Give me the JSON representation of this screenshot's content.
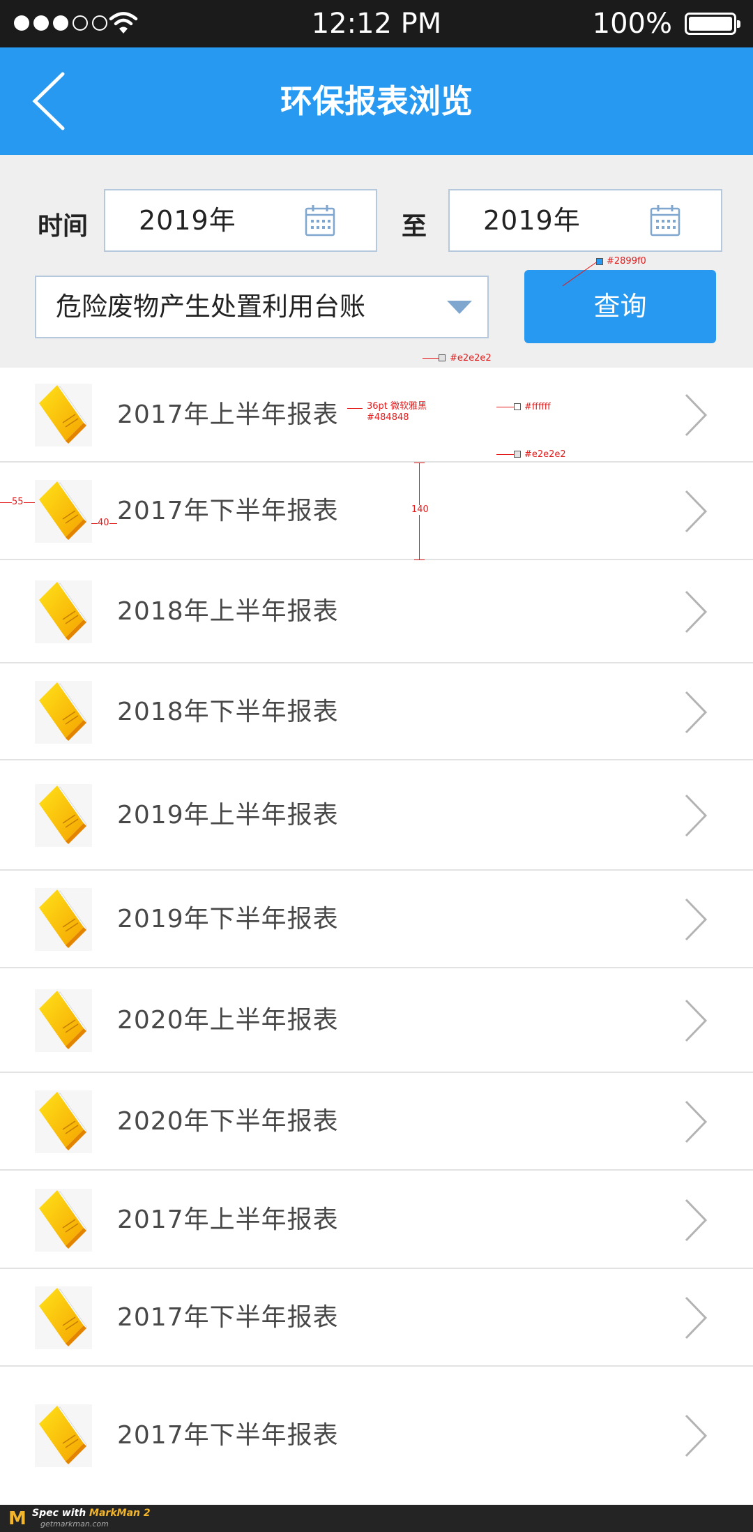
{
  "status_bar": {
    "time": "12:12 PM",
    "battery": "100%",
    "signal_level": 3,
    "signal_max": 5
  },
  "nav": {
    "title": "环保报表浏览",
    "back_icon": "chevron-left-icon"
  },
  "filter": {
    "time_label": "时间",
    "to_label": "至",
    "start_value": "2019年",
    "end_value": "2019年",
    "calendar_icon": "calendar-icon",
    "select_value": "危险废物产生处置利用台账",
    "query_button": "查询"
  },
  "reports": [
    {
      "label": "2017年上半年报表"
    },
    {
      "label": "2017年下半年报表"
    },
    {
      "label": "2018年上半年报表"
    },
    {
      "label": "2018年下半年报表"
    },
    {
      "label": "2019年上半年报表"
    },
    {
      "label": "2019年下半年报表"
    },
    {
      "label": "2020年上半年报表"
    },
    {
      "label": "2020年下半年报表"
    },
    {
      "label": "2017年上半年报表"
    },
    {
      "label": "2017年下半年报表"
    },
    {
      "label": "2017年下半年报表"
    }
  ],
  "annotations": {
    "button_color": "#2899f0",
    "divider_color": "#e2e2e2",
    "font_spec": "36pt 微软雅黑",
    "font_color": "#484848",
    "row_bg": "#ffffff",
    "divider_color_2": "#e2e2e2",
    "row_height": "140",
    "left_margin": "55",
    "icon_gap": "40"
  },
  "footer": {
    "logo": "M",
    "spec_with": "Spec with ",
    "product": "MarkMan 2",
    "site": "getmarkman.com"
  },
  "colors": {
    "primary": "#2899f0",
    "list_text": "#484848",
    "divider": "#e2e2e2",
    "filter_bg": "#efefef"
  }
}
